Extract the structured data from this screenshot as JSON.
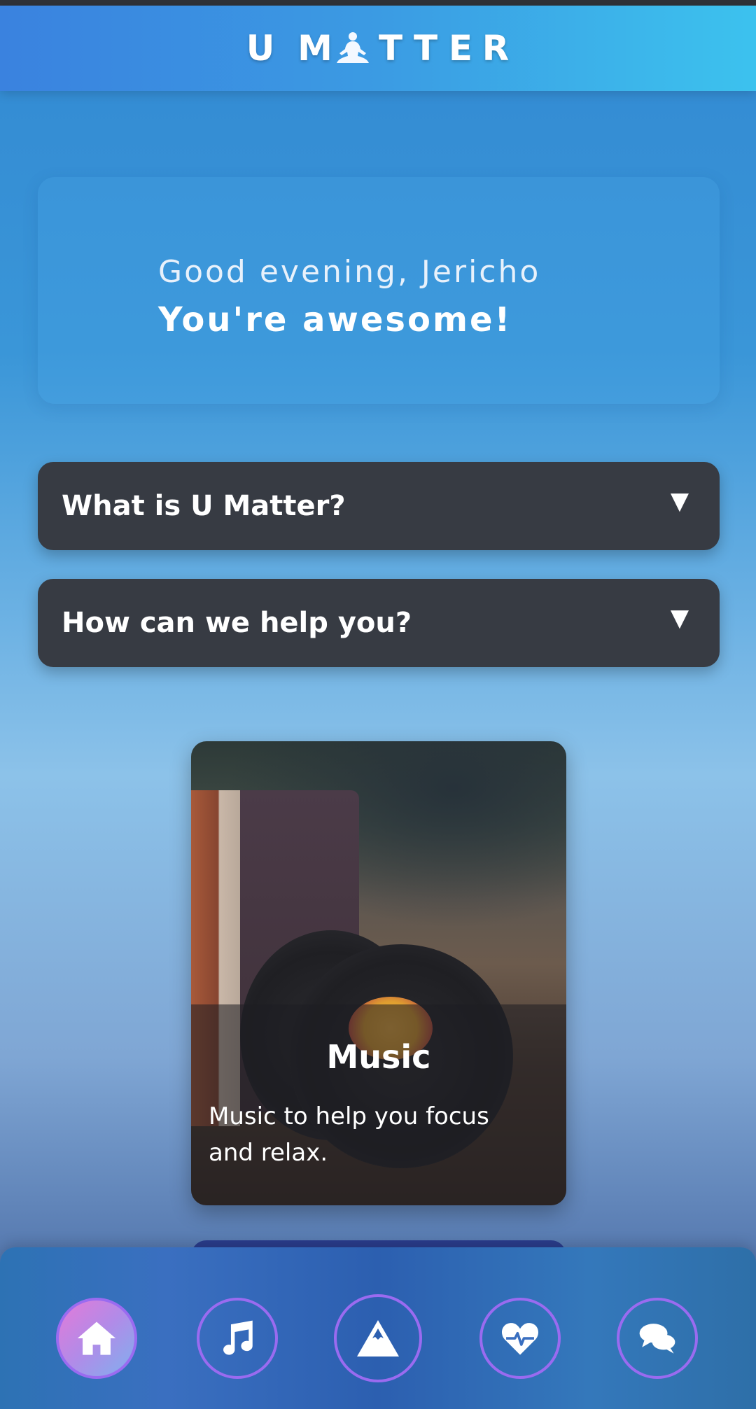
{
  "header": {
    "logo_letters": [
      "U",
      "M",
      "T",
      "T",
      "E",
      "R"
    ],
    "logo_icon": "meditation-icon"
  },
  "greeting": {
    "line1": "Good evening, Jericho",
    "line2": "You're awesome!"
  },
  "accordions": [
    {
      "question": "What is U Matter?",
      "arrow": "▼"
    },
    {
      "question": "How can we help you?",
      "arrow": "▼"
    }
  ],
  "music_card": {
    "title": "Music",
    "description": "Music to help you focus and relax."
  },
  "bottom_nav": {
    "items": [
      {
        "icon": "home-icon",
        "active": true
      },
      {
        "icon": "music-note-icon",
        "active": false
      },
      {
        "icon": "mountain-icon",
        "active": false
      },
      {
        "icon": "heartbeat-icon",
        "active": false
      },
      {
        "icon": "chat-icon",
        "active": false
      }
    ]
  },
  "colors": {
    "accordion_bg": "#373b43",
    "nav_ring": "#9a6bf0",
    "header_gradient_start": "#3a82df",
    "header_gradient_end": "#3cc2ee"
  }
}
